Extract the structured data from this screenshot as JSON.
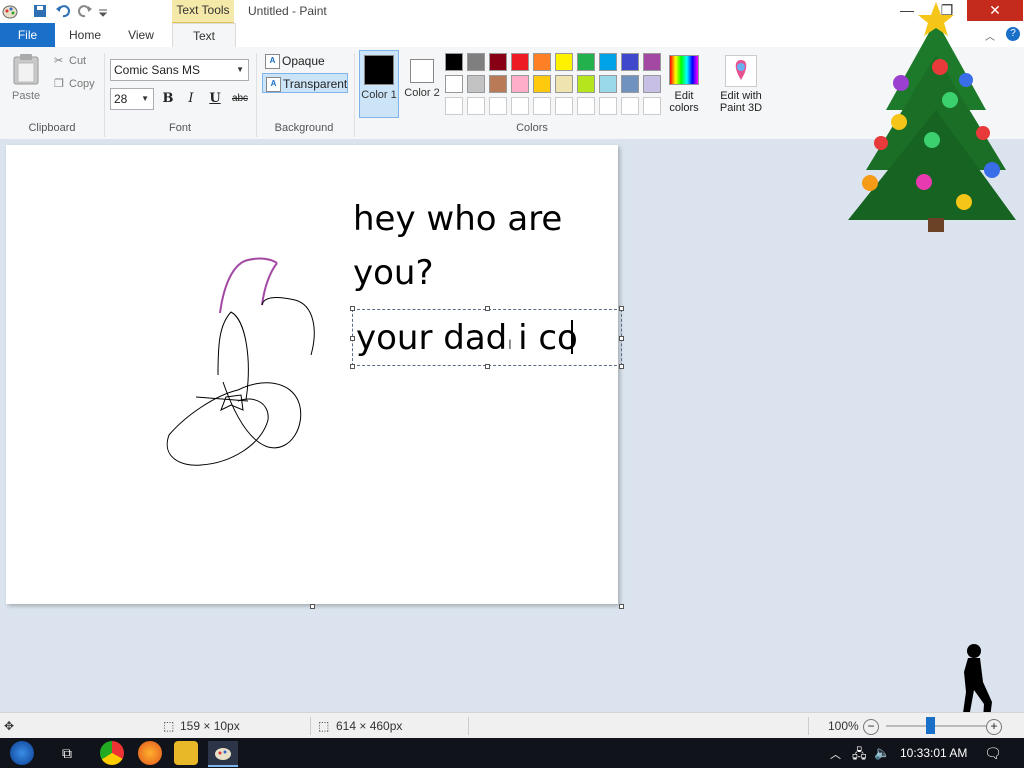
{
  "window": {
    "title": "Untitled - Paint",
    "contextual_tab": "Text Tools",
    "minimize_glyph": "—",
    "maximize_glyph": "❐",
    "close_glyph": "✕"
  },
  "tabs": {
    "file": "File",
    "home": "Home",
    "view": "View",
    "text": "Text"
  },
  "clipboard": {
    "paste": "Paste",
    "cut": "Cut",
    "copy": "Copy",
    "label": "Clipboard"
  },
  "font": {
    "family": "Comic Sans MS",
    "size": "28",
    "bold": "B",
    "italic": "I",
    "underline": "U",
    "strike": "abc",
    "label": "Font"
  },
  "background": {
    "opaque": "Opaque",
    "transparent": "Transparent",
    "label": "Background",
    "selected": "Transparent"
  },
  "colors": {
    "color1_label": "Color 1",
    "color2_label": "Color 2",
    "color1": "#000000",
    "color2": "#ffffff",
    "edit_colors": "Edit colors",
    "edit_paint3d": "Edit with Paint 3D",
    "label": "Colors",
    "palette_row1": [
      "#000000",
      "#7f7f7f",
      "#880015",
      "#ed1c24",
      "#ff7f27",
      "#fff200",
      "#22b14c",
      "#00a2e8",
      "#3f48cc",
      "#a349a4"
    ],
    "palette_row2": [
      "#ffffff",
      "#c3c3c3",
      "#b97a57",
      "#ffaec9",
      "#ffc90e",
      "#efe4b0",
      "#b5e61d",
      "#99d9ea",
      "#7092be",
      "#c8bfe7"
    ]
  },
  "canvas": {
    "line1": "hey who are",
    "line2": "you?",
    "editing_text": "your dad i co"
  },
  "status": {
    "selection_size": "159 × 10px",
    "canvas_size": "614 × 460px",
    "zoom": "100%"
  },
  "taskbar": {
    "time": "10:33:01 AM"
  }
}
